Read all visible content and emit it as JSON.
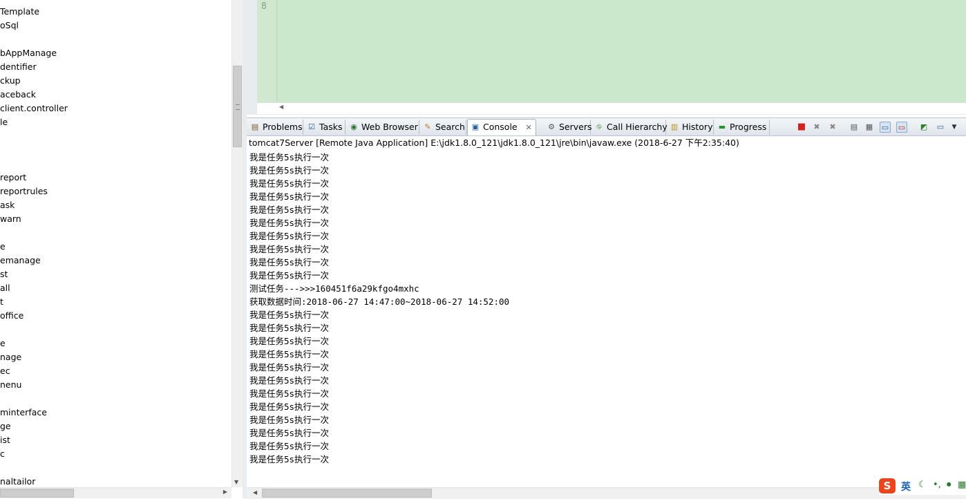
{
  "tree": [
    "Template",
    "oSql",
    "bAppManage",
    "dentifier",
    "ckup",
    "aceback",
    "client.controller",
    "le",
    "report",
    "reportrules",
    "ask",
    "warn",
    "e",
    "emanage",
    "st",
    "all",
    "t",
    "office",
    "e",
    "nage",
    "ec",
    "nenu",
    "minterface",
    "ge",
    "ist",
    "c",
    "naltailor"
  ],
  "editor": {
    "line_number": "8"
  },
  "tabs": [
    {
      "label": "Problems",
      "icon": "problems-icon"
    },
    {
      "label": "Tasks",
      "icon": "tasks-icon"
    },
    {
      "label": "Web Browser",
      "icon": "web-browser-icon"
    },
    {
      "label": "Search",
      "icon": "search-icon"
    },
    {
      "label": "Console",
      "icon": "console-icon",
      "close": "✕"
    },
    {
      "label": "Servers",
      "icon": "servers-icon"
    },
    {
      "label": "Call Hierarchy",
      "icon": "call-hierarchy-icon"
    },
    {
      "label": "History",
      "icon": "history-icon"
    },
    {
      "label": "Progress",
      "icon": "progress-icon"
    }
  ],
  "process_line": "tomcat7Server [Remote Java Application] E:\\jdk1.8.0_121\\jdk1.8.0_121\\jre\\bin\\javaw.exe (2018-6-27 下午2:35:40)",
  "console_lines": [
    "我是任务5s执行一次",
    "我是任务5s执行一次",
    "我是任务5s执行一次",
    "我是任务5s执行一次",
    "我是任务5s执行一次",
    "我是任务5s执行一次",
    "我是任务5s执行一次",
    "我是任务5s执行一次",
    "我是任务5s执行一次",
    "我是任务5s执行一次",
    "测试任务--->>>160451f6a29kfgo4mxhc",
    "获取数据时间:2018-06-27 14:47:00~2018-06-27 14:52:00",
    "我是任务5s执行一次",
    "我是任务5s执行一次",
    "我是任务5s执行一次",
    "我是任务5s执行一次",
    "我是任务5s执行一次",
    "我是任务5s执行一次",
    "我是任务5s执行一次",
    "我是任务5s执行一次",
    "我是任务5s执行一次",
    "我是任务5s执行一次",
    "我是任务5s执行一次",
    "我是任务5s执行一次"
  ],
  "ime": {
    "logo": "S",
    "lang": "英"
  },
  "colors": {
    "editor_bg": "#cce8cc",
    "terminate": "#d42020",
    "ime_logo": "#e8461f"
  }
}
